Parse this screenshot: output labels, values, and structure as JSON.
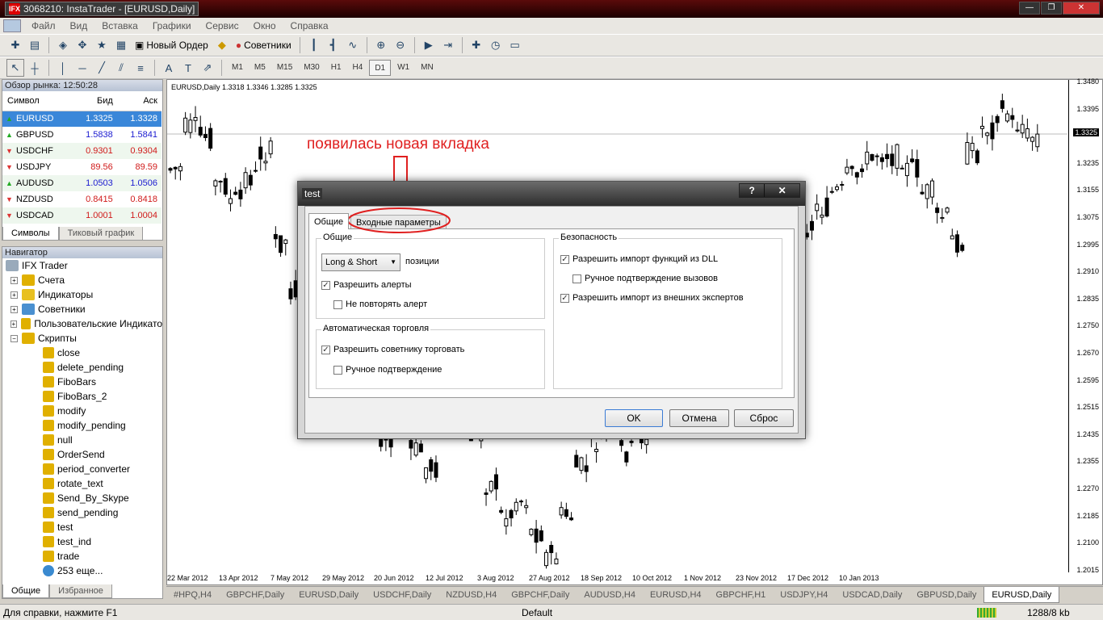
{
  "window": {
    "title": "3068210: InstaTrader - [EURUSD,Daily]",
    "app_icon": "app-logo-icon"
  },
  "menu": [
    "Файл",
    "Вид",
    "Вставка",
    "Графики",
    "Сервис",
    "Окно",
    "Справка"
  ],
  "toolbar1": {
    "new_order": "Новый Ордер",
    "experts": "Советники"
  },
  "timeframes": [
    "M1",
    "M5",
    "M15",
    "M30",
    "H1",
    "H4",
    "D1",
    "W1",
    "MN"
  ],
  "timeframe_active": "D1",
  "market_watch": {
    "title": "Обзор рынка: 12:50:28",
    "columns": [
      "Символ",
      "Бид",
      "Аск"
    ],
    "rows": [
      {
        "sym": "EURUSD",
        "bid": "1.3325",
        "ask": "1.3328",
        "dir": "up"
      },
      {
        "sym": "GBPUSD",
        "bid": "1.5838",
        "ask": "1.5841",
        "dir": "up"
      },
      {
        "sym": "USDCHF",
        "bid": "0.9301",
        "ask": "0.9304",
        "dir": "down"
      },
      {
        "sym": "USDJPY",
        "bid": "89.56",
        "ask": "89.59",
        "dir": "down"
      },
      {
        "sym": "AUDUSD",
        "bid": "1.0503",
        "ask": "1.0506",
        "dir": "up"
      },
      {
        "sym": "NZDUSD",
        "bid": "0.8415",
        "ask": "0.8418",
        "dir": "down"
      },
      {
        "sym": "USDCAD",
        "bid": "1.0001",
        "ask": "1.0004",
        "dir": "down"
      }
    ],
    "tabs": [
      "Символы",
      "Тиковый график"
    ]
  },
  "navigator": {
    "title": "Навигатор",
    "root": "IFX Trader",
    "groups": [
      "Счета",
      "Индикаторы",
      "Советники",
      "Пользовательские Индикато",
      "Скрипты"
    ],
    "scripts": [
      "close",
      "delete_pending",
      "FiboBars",
      "FiboBars_2",
      "modify",
      "modify_pending",
      "null",
      "OrderSend",
      "period_converter",
      "rotate_text",
      "Send_By_Skype",
      "send_pending",
      "test",
      "test_ind",
      "trade",
      "253 еще..."
    ],
    "tabs": [
      "Общие",
      "Избранное"
    ]
  },
  "chart": {
    "info": "EURUSD,Daily  1.3318 1.3346 1.3285 1.3325",
    "current_price": "1.3325",
    "y_labels": [
      "1.3480",
      "1.3395",
      "1.3325",
      "1.3235",
      "1.3155",
      "1.3075",
      "1.2995",
      "1.2910",
      "1.2835",
      "1.2750",
      "1.2670",
      "1.2595",
      "1.2515",
      "1.2435",
      "1.2355",
      "1.2270",
      "1.2185",
      "1.2100",
      "1.2015"
    ],
    "x_labels": [
      "22 Mar 2012",
      "13 Apr 2012",
      "7 May 2012",
      "29 May 2012",
      "20 Jun 2012",
      "12 Jul 2012",
      "3 Aug 2012",
      "27 Aug 2012",
      "18 Sep 2012",
      "10 Oct 2012",
      "1 Nov 2012",
      "23 Nov 2012",
      "17 Dec 2012",
      "10 Jan 2013"
    ]
  },
  "chart_tabs": [
    "#HPQ,H4",
    "GBPCHF,Daily",
    "EURUSD,Daily",
    "USDCHF,Daily",
    "NZDUSD,H4",
    "GBPCHF,Daily",
    "AUDUSD,H4",
    "EURUSD,H4",
    "GBPCHF,H1",
    "USDJPY,H4",
    "USDCAD,Daily",
    "GBPUSD,Daily",
    "EURUSD,Daily"
  ],
  "status": {
    "help": "Для справки, нажмите F1",
    "profile": "Default",
    "traffic": "1288/8 kb"
  },
  "annotation": "появилась новая вкладка",
  "dialog": {
    "title": "test",
    "tabs": [
      "Общие",
      "Входные параметры"
    ],
    "group_general": "Общие",
    "positions_value": "Long & Short",
    "positions_label": "позиции",
    "allow_alerts": "Разрешить алерты",
    "no_repeat_alert": "Не повторять алерт",
    "group_auto": "Автоматическая торговля",
    "allow_trading": "Разрешить советнику торговать",
    "manual_confirm": "Ручное подтверждение",
    "group_security": "Безопасность",
    "allow_dll": "Разрешить импорт функций из DLL",
    "manual_calls": "Ручное подтверждение вызовов",
    "allow_import": "Разрешить импорт из внешних экспертов",
    "ok": "OK",
    "cancel": "Отмена",
    "reset": "Сброс"
  }
}
